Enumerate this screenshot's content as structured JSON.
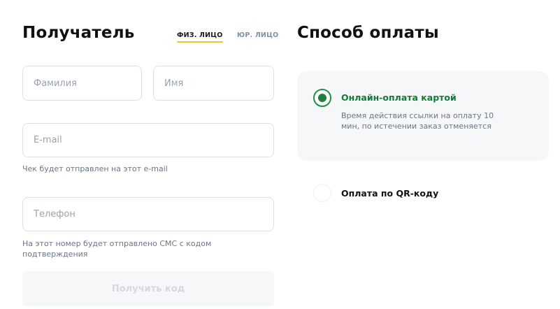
{
  "recipient": {
    "title": "Получатель",
    "tabs": [
      {
        "label": "ФИЗ. ЛИЦО",
        "active": true
      },
      {
        "label": "ЮР. ЛИЦО",
        "active": false
      }
    ],
    "surname_placeholder": "Фамилия",
    "name_placeholder": "Имя",
    "email_placeholder": "E-mail",
    "email_hint": "Чек будет отправлен на этот e-mail",
    "phone_placeholder": "Телефон",
    "phone_hint": "На этот номер будет отправлено СМС с кодом подтверждения",
    "get_code_label": "Получить код"
  },
  "payment": {
    "title": "Способ оплаты",
    "options": [
      {
        "label": "Онлайн-оплата картой",
        "description": "Время действия ссылки на оплату 10 мин, по истечении заказ отменяется",
        "selected": true
      },
      {
        "label": "Оплата по QR-коду",
        "selected": false
      }
    ]
  },
  "colors": {
    "accent_green": "#137a37",
    "tab_underline": "#f2c62a",
    "hint_text": "#6b7684"
  }
}
